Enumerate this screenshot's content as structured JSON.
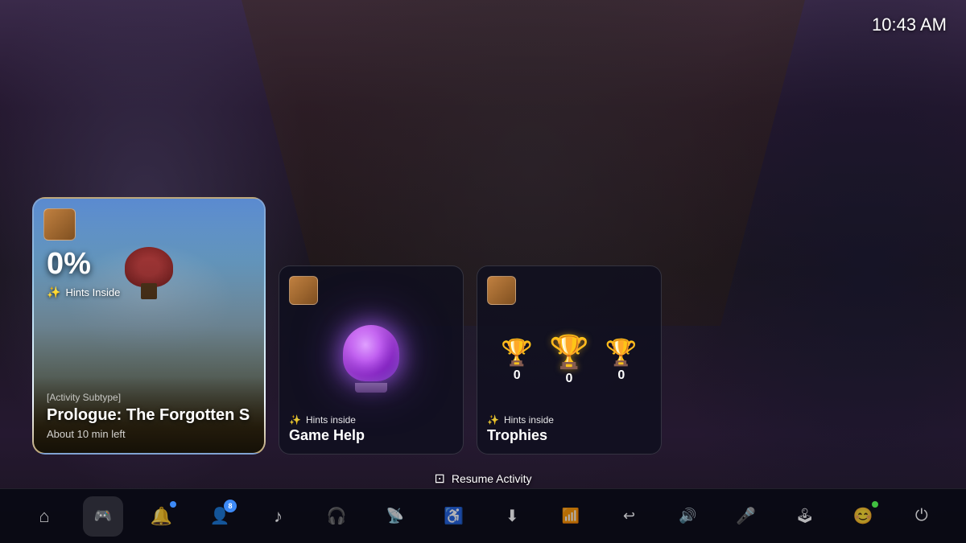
{
  "clock": "10:43 AM",
  "background": {
    "scene": "game-world-rpg"
  },
  "activity_card": {
    "progress": "0%",
    "hints_label": "Hints Inside",
    "activity_subtype": "[Activity Subtype]",
    "title": "Prologue: The Forgotten S",
    "time_left": "About 10 min left"
  },
  "game_help_card": {
    "hints_label": "Hints inside",
    "title": "Game Help"
  },
  "trophies_card": {
    "hints_label": "Hints inside",
    "title": "Trophies",
    "silver_count": "0",
    "gold_count": "0",
    "bronze_count": "0"
  },
  "resume_bar": {
    "label": "Resume Activity"
  },
  "bottom_nav": {
    "items": [
      {
        "id": "home",
        "icon": "⌂",
        "active": false
      },
      {
        "id": "game",
        "icon": "🎮",
        "active": true
      },
      {
        "id": "notifications",
        "icon": "🔔",
        "active": false,
        "dot": true
      },
      {
        "id": "friends",
        "icon": "👤",
        "active": false,
        "badge": "8"
      },
      {
        "id": "music",
        "icon": "♪",
        "active": false
      },
      {
        "id": "podcast",
        "icon": "🎙",
        "active": false
      },
      {
        "id": "radio",
        "icon": "📡",
        "active": false
      },
      {
        "id": "accessibility",
        "icon": "⊕",
        "active": false
      },
      {
        "id": "download",
        "icon": "⬇",
        "active": false
      },
      {
        "id": "feed",
        "icon": "📶",
        "active": false
      },
      {
        "id": "share",
        "icon": "↩",
        "active": false
      },
      {
        "id": "volume",
        "icon": "🔊",
        "active": false
      },
      {
        "id": "mic",
        "icon": "🎤",
        "active": false
      },
      {
        "id": "controller",
        "icon": "🎮",
        "active": false
      },
      {
        "id": "profile",
        "icon": "😊",
        "active": false,
        "dot_green": true
      },
      {
        "id": "power",
        "icon": "⏻",
        "active": false
      }
    ]
  }
}
